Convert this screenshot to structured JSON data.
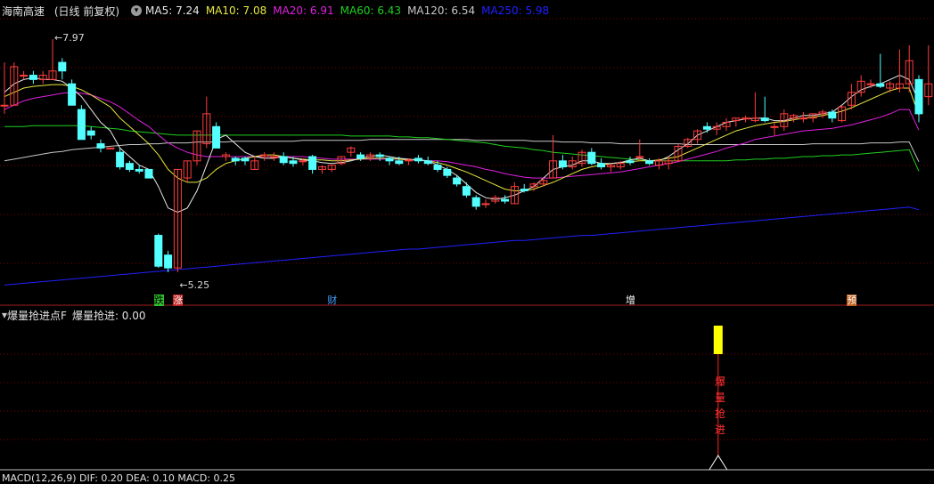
{
  "stock": {
    "name": "海南高速",
    "period": "(日线 前复权)"
  },
  "ma_legend": [
    {
      "label": "MA5: 7.24",
      "color": "#e8e8e8"
    },
    {
      "label": "MA10: 7.08",
      "color": "#e8e840"
    },
    {
      "label": "MA20: 6.91",
      "color": "#e020e0"
    },
    {
      "label": "MA60: 6.43",
      "color": "#20d020"
    },
    {
      "label": "MA120: 6.54",
      "color": "#c8c8c8"
    },
    {
      "label": "MA250: 5.98",
      "color": "#2020ff"
    }
  ],
  "price_marks": {
    "high": "7.97",
    "low": "5.25"
  },
  "event_markers": [
    {
      "text": "跌",
      "fg": "#000000",
      "bg": "#30c030"
    },
    {
      "text": "涨",
      "fg": "#ffffff",
      "bg": "#c02020"
    },
    {
      "text": "财",
      "fg": "#40a0ff",
      "bg": "none"
    },
    {
      "text": "增",
      "fg": "#ffffff",
      "bg": "none"
    },
    {
      "text": "预",
      "fg": "#ffffff",
      "bg": "#c06020"
    }
  ],
  "indicator": {
    "name": "爆量抢进点F",
    "value_label": "爆量抢进: 0.00",
    "signal_text": "爆量抢进"
  },
  "macd_legend": "MACD(12,26,9)  DIF: 0.20  DEA: 0.10  MACD: 0.25",
  "colors": {
    "up": "#ff3c3c",
    "down": "#54ffff",
    "signal_bar": "#ffff00",
    "grid": "#800000"
  },
  "chart_data": {
    "type": "candlestick",
    "y_axis_price": [
      5.0,
      8.2
    ],
    "candles": [
      {
        "o": 7.2,
        "h": 7.7,
        "l": 7.1,
        "c": 7.2
      },
      {
        "o": 7.2,
        "h": 7.7,
        "l": 7.2,
        "c": 7.65
      },
      {
        "o": 7.55,
        "h": 7.6,
        "l": 7.5,
        "c": 7.55
      },
      {
        "o": 7.55,
        "h": 7.6,
        "l": 7.45,
        "c": 7.5
      },
      {
        "o": 7.5,
        "h": 7.6,
        "l": 7.45,
        "c": 7.55
      },
      {
        "o": 7.5,
        "h": 7.97,
        "l": 7.5,
        "c": 7.6
      },
      {
        "o": 7.7,
        "h": 7.75,
        "l": 7.5,
        "c": 7.6
      },
      {
        "o": 7.45,
        "h": 7.5,
        "l": 7.2,
        "c": 7.2
      },
      {
        "o": 7.15,
        "h": 7.2,
        "l": 6.8,
        "c": 6.8
      },
      {
        "o": 6.9,
        "h": 6.95,
        "l": 6.8,
        "c": 6.85
      },
      {
        "o": 6.75,
        "h": 6.8,
        "l": 6.65,
        "c": 6.7
      },
      {
        "o": 6.7,
        "h": 6.7,
        "l": 6.7,
        "c": 6.7
      },
      {
        "o": 6.65,
        "h": 6.7,
        "l": 6.45,
        "c": 6.48
      },
      {
        "o": 6.52,
        "h": 6.55,
        "l": 6.42,
        "c": 6.45
      },
      {
        "o": 6.45,
        "h": 6.5,
        "l": 6.4,
        "c": 6.43
      },
      {
        "o": 6.45,
        "h": 6.45,
        "l": 6.4,
        "c": 6.35
      },
      {
        "o": 5.68,
        "h": 5.7,
        "l": 5.3,
        "c": 5.32
      },
      {
        "o": 5.45,
        "h": 5.5,
        "l": 5.25,
        "c": 5.3
      },
      {
        "o": 5.3,
        "h": 6.45,
        "l": 5.25,
        "c": 6.45
      },
      {
        "o": 6.35,
        "h": 6.55,
        "l": 6.3,
        "c": 6.55
      },
      {
        "o": 6.55,
        "h": 6.9,
        "l": 6.5,
        "c": 6.9
      },
      {
        "o": 6.75,
        "h": 7.3,
        "l": 6.7,
        "c": 7.1
      },
      {
        "o": 6.95,
        "h": 7.0,
        "l": 6.8,
        "c": 6.7
      },
      {
        "o": 6.6,
        "h": 6.65,
        "l": 6.55,
        "c": 6.62
      },
      {
        "o": 6.58,
        "h": 6.6,
        "l": 6.5,
        "c": 6.55
      },
      {
        "o": 6.58,
        "h": 6.6,
        "l": 6.5,
        "c": 6.55
      },
      {
        "o": 6.45,
        "h": 6.6,
        "l": 6.45,
        "c": 6.55
      },
      {
        "o": 6.6,
        "h": 6.65,
        "l": 6.55,
        "c": 6.62
      },
      {
        "o": 6.6,
        "h": 6.65,
        "l": 6.55,
        "c": 6.6
      },
      {
        "o": 6.6,
        "h": 6.65,
        "l": 6.5,
        "c": 6.53
      },
      {
        "o": 6.55,
        "h": 6.6,
        "l": 6.48,
        "c": 6.52
      },
      {
        "o": 6.55,
        "h": 6.58,
        "l": 6.5,
        "c": 6.55
      },
      {
        "o": 6.6,
        "h": 6.62,
        "l": 6.4,
        "c": 6.45
      },
      {
        "o": 6.45,
        "h": 6.5,
        "l": 6.4,
        "c": 6.48
      },
      {
        "o": 6.45,
        "h": 6.5,
        "l": 6.42,
        "c": 6.5
      },
      {
        "o": 6.52,
        "h": 6.6,
        "l": 6.5,
        "c": 6.6
      },
      {
        "o": 6.65,
        "h": 6.72,
        "l": 6.6,
        "c": 6.7
      },
      {
        "o": 6.62,
        "h": 6.65,
        "l": 6.55,
        "c": 6.58
      },
      {
        "o": 6.6,
        "h": 6.65,
        "l": 6.55,
        "c": 6.62
      },
      {
        "o": 6.62,
        "h": 6.65,
        "l": 6.55,
        "c": 6.6
      },
      {
        "o": 6.58,
        "h": 6.6,
        "l": 6.5,
        "c": 6.55
      },
      {
        "o": 6.55,
        "h": 6.6,
        "l": 6.5,
        "c": 6.52
      },
      {
        "o": 6.55,
        "h": 6.58,
        "l": 6.5,
        "c": 6.56
      },
      {
        "o": 6.58,
        "h": 6.62,
        "l": 6.52,
        "c": 6.55
      },
      {
        "o": 6.55,
        "h": 6.6,
        "l": 6.5,
        "c": 6.52
      },
      {
        "o": 6.5,
        "h": 6.55,
        "l": 6.42,
        "c": 6.45
      },
      {
        "o": 6.45,
        "h": 6.48,
        "l": 6.35,
        "c": 6.38
      },
      {
        "o": 6.35,
        "h": 6.38,
        "l": 6.25,
        "c": 6.28
      },
      {
        "o": 6.25,
        "h": 6.3,
        "l": 6.12,
        "c": 6.15
      },
      {
        "o": 6.12,
        "h": 6.15,
        "l": 5.98,
        "c": 6.02
      },
      {
        "o": 6.05,
        "h": 6.1,
        "l": 6.0,
        "c": 6.05
      },
      {
        "o": 6.08,
        "h": 6.15,
        "l": 6.05,
        "c": 6.12
      },
      {
        "o": 6.1,
        "h": 6.15,
        "l": 6.05,
        "c": 6.08
      },
      {
        "o": 6.05,
        "h": 6.3,
        "l": 6.05,
        "c": 6.25
      },
      {
        "o": 6.22,
        "h": 6.28,
        "l": 6.18,
        "c": 6.2
      },
      {
        "o": 6.25,
        "h": 6.3,
        "l": 6.2,
        "c": 6.28
      },
      {
        "o": 6.28,
        "h": 6.35,
        "l": 6.25,
        "c": 6.32
      },
      {
        "o": 6.35,
        "h": 6.85,
        "l": 6.35,
        "c": 6.55
      },
      {
        "o": 6.55,
        "h": 6.62,
        "l": 6.45,
        "c": 6.48
      },
      {
        "o": 6.48,
        "h": 6.6,
        "l": 6.45,
        "c": 6.55
      },
      {
        "o": 6.52,
        "h": 6.68,
        "l": 6.48,
        "c": 6.65
      },
      {
        "o": 6.65,
        "h": 6.7,
        "l": 6.5,
        "c": 6.52
      },
      {
        "o": 6.52,
        "h": 6.58,
        "l": 6.45,
        "c": 6.48
      },
      {
        "o": 6.48,
        "h": 6.52,
        "l": 6.42,
        "c": 6.5
      },
      {
        "o": 6.48,
        "h": 6.55,
        "l": 6.45,
        "c": 6.52
      },
      {
        "o": 6.55,
        "h": 6.6,
        "l": 6.5,
        "c": 6.53
      },
      {
        "o": 6.6,
        "h": 6.8,
        "l": 6.55,
        "c": 6.6
      },
      {
        "o": 6.55,
        "h": 6.58,
        "l": 6.5,
        "c": 6.52
      },
      {
        "o": 6.5,
        "h": 6.58,
        "l": 6.45,
        "c": 6.55
      },
      {
        "o": 6.52,
        "h": 6.6,
        "l": 6.45,
        "c": 6.55
      },
      {
        "o": 6.55,
        "h": 6.75,
        "l": 6.55,
        "c": 6.72
      },
      {
        "o": 6.72,
        "h": 6.82,
        "l": 6.7,
        "c": 6.8
      },
      {
        "o": 6.8,
        "h": 6.92,
        "l": 6.75,
        "c": 6.9
      },
      {
        "o": 6.95,
        "h": 7.0,
        "l": 6.88,
        "c": 6.92
      },
      {
        "o": 6.92,
        "h": 7.0,
        "l": 6.85,
        "c": 6.95
      },
      {
        "o": 6.95,
        "h": 7.05,
        "l": 6.9,
        "c": 7.0
      },
      {
        "o": 7.02,
        "h": 7.05,
        "l": 6.95,
        "c": 7.05
      },
      {
        "o": 7.05,
        "h": 7.08,
        "l": 7.0,
        "c": 7.05
      },
      {
        "o": 7.02,
        "h": 7.35,
        "l": 7.0,
        "c": 7.05
      },
      {
        "o": 7.05,
        "h": 7.3,
        "l": 7.0,
        "c": 7.02
      },
      {
        "o": 6.95,
        "h": 7.0,
        "l": 6.85,
        "c": 6.95
      },
      {
        "o": 6.95,
        "h": 7.15,
        "l": 6.9,
        "c": 7.1
      },
      {
        "o": 7.05,
        "h": 7.1,
        "l": 7.0,
        "c": 7.08
      },
      {
        "o": 7.05,
        "h": 7.12,
        "l": 7.0,
        "c": 7.05
      },
      {
        "o": 7.05,
        "h": 7.1,
        "l": 7.0,
        "c": 7.1
      },
      {
        "o": 7.1,
        "h": 7.15,
        "l": 7.05,
        "c": 7.12
      },
      {
        "o": 7.12,
        "h": 7.15,
        "l": 7.0,
        "c": 7.05
      },
      {
        "o": 7.02,
        "h": 7.2,
        "l": 7.0,
        "c": 7.18
      },
      {
        "o": 7.2,
        "h": 7.45,
        "l": 7.15,
        "c": 7.35
      },
      {
        "o": 7.35,
        "h": 7.55,
        "l": 7.3,
        "c": 7.48
      },
      {
        "o": 7.45,
        "h": 7.5,
        "l": 7.4,
        "c": 7.45
      },
      {
        "o": 7.45,
        "h": 7.8,
        "l": 7.4,
        "c": 7.42
      },
      {
        "o": 7.4,
        "h": 7.48,
        "l": 7.35,
        "c": 7.45
      },
      {
        "o": 7.4,
        "h": 7.85,
        "l": 7.35,
        "c": 7.45
      },
      {
        "o": 7.45,
        "h": 7.9,
        "l": 7.35,
        "c": 7.72
      },
      {
        "o": 7.5,
        "h": 7.55,
        "l": 7.0,
        "c": 7.1
      },
      {
        "o": 7.3,
        "h": 7.9,
        "l": 7.2,
        "c": 7.45
      }
    ],
    "ma5": [
      7.35,
      7.45,
      7.5,
      7.52,
      7.5,
      7.5,
      7.48,
      7.4,
      7.3,
      7.15,
      7.0,
      6.9,
      6.7,
      6.6,
      6.5,
      6.45,
      6.25,
      6.0,
      5.95,
      6.0,
      6.2,
      6.5,
      6.8,
      6.85,
      6.75,
      6.65,
      6.6,
      6.58,
      6.58,
      6.6,
      6.58,
      6.56,
      6.55,
      6.53,
      6.52,
      6.53,
      6.55,
      6.58,
      6.6,
      6.62,
      6.6,
      6.58,
      6.57,
      6.56,
      6.55,
      6.5,
      6.45,
      6.38,
      6.28,
      6.18,
      6.12,
      6.1,
      6.12,
      6.15,
      6.2,
      6.25,
      6.35,
      6.45,
      6.48,
      6.5,
      6.55,
      6.55,
      6.52,
      6.52,
      6.53,
      6.56,
      6.58,
      6.55,
      6.55,
      6.6,
      6.68,
      6.75,
      6.85,
      6.9,
      6.95,
      7.0,
      7.02,
      7.04,
      7.05,
      7.05,
      7.02,
      7.02,
      7.05,
      7.08,
      7.08,
      7.1,
      7.12,
      7.2,
      7.3,
      7.38,
      7.42,
      7.45,
      7.5,
      7.55,
      7.5,
      7.24
    ],
    "ma10": [
      7.3,
      7.35,
      7.4,
      7.42,
      7.43,
      7.44,
      7.44,
      7.42,
      7.38,
      7.32,
      7.25,
      7.18,
      7.05,
      6.95,
      6.85,
      6.75,
      6.62,
      6.45,
      6.35,
      6.3,
      6.3,
      6.35,
      6.45,
      6.52,
      6.55,
      6.58,
      6.6,
      6.62,
      6.62,
      6.6,
      6.58,
      6.57,
      6.56,
      6.56,
      6.55,
      6.55,
      6.56,
      6.57,
      6.58,
      6.58,
      6.58,
      6.57,
      6.56,
      6.56,
      6.55,
      6.53,
      6.5,
      6.46,
      6.42,
      6.37,
      6.32,
      6.27,
      6.22,
      6.2,
      6.2,
      6.22,
      6.26,
      6.3,
      6.35,
      6.4,
      6.45,
      6.48,
      6.5,
      6.52,
      6.53,
      6.54,
      6.55,
      6.55,
      6.56,
      6.58,
      6.6,
      6.65,
      6.7,
      6.75,
      6.8,
      6.85,
      6.9,
      6.93,
      6.96,
      6.98,
      7.0,
      7.01,
      7.03,
      7.05,
      7.06,
      7.08,
      7.1,
      7.13,
      7.17,
      7.22,
      7.27,
      7.32,
      7.37,
      7.4,
      7.4,
      7.08
    ],
    "ma20": [
      7.15,
      7.2,
      7.25,
      7.28,
      7.3,
      7.32,
      7.34,
      7.35,
      7.34,
      7.32,
      7.28,
      7.24,
      7.18,
      7.1,
      7.02,
      6.95,
      6.85,
      6.76,
      6.7,
      6.65,
      6.62,
      6.6,
      6.6,
      6.6,
      6.6,
      6.6,
      6.6,
      6.6,
      6.6,
      6.6,
      6.6,
      6.6,
      6.59,
      6.58,
      6.57,
      6.57,
      6.57,
      6.57,
      6.57,
      6.57,
      6.57,
      6.57,
      6.56,
      6.56,
      6.55,
      6.55,
      6.54,
      6.52,
      6.5,
      6.48,
      6.45,
      6.43,
      6.4,
      6.38,
      6.36,
      6.35,
      6.35,
      6.35,
      6.36,
      6.37,
      6.38,
      6.39,
      6.4,
      6.41,
      6.42,
      6.44,
      6.46,
      6.48,
      6.5,
      6.52,
      6.54,
      6.57,
      6.6,
      6.63,
      6.66,
      6.7,
      6.73,
      6.76,
      6.8,
      6.82,
      6.84,
      6.86,
      6.88,
      6.9,
      6.91,
      6.92,
      6.93,
      6.95,
      6.97,
      7.0,
      7.03,
      7.06,
      7.1,
      7.15,
      7.15,
      6.91
    ],
    "ma60": [
      6.95,
      6.95,
      6.95,
      6.96,
      6.96,
      6.96,
      6.96,
      6.96,
      6.96,
      6.95,
      6.94,
      6.93,
      6.92,
      6.9,
      6.89,
      6.88,
      6.87,
      6.86,
      6.85,
      6.85,
      6.85,
      6.85,
      6.85,
      6.85,
      6.85,
      6.85,
      6.85,
      6.85,
      6.85,
      6.85,
      6.85,
      6.85,
      6.85,
      6.85,
      6.85,
      6.85,
      6.84,
      6.84,
      6.84,
      6.84,
      6.84,
      6.83,
      6.83,
      6.82,
      6.82,
      6.81,
      6.8,
      6.79,
      6.78,
      6.77,
      6.76,
      6.74,
      6.72,
      6.71,
      6.7,
      6.68,
      6.67,
      6.65,
      6.64,
      6.63,
      6.62,
      6.61,
      6.6,
      6.59,
      6.58,
      6.57,
      6.56,
      6.55,
      6.55,
      6.55,
      6.55,
      6.55,
      6.55,
      6.55,
      6.55,
      6.55,
      6.56,
      6.56,
      6.57,
      6.57,
      6.58,
      6.58,
      6.59,
      6.6,
      6.6,
      6.61,
      6.61,
      6.62,
      6.62,
      6.63,
      6.64,
      6.65,
      6.66,
      6.67,
      6.68,
      6.43
    ],
    "ma120": [
      6.55,
      6.57,
      6.59,
      6.61,
      6.63,
      6.65,
      6.66,
      6.68,
      6.69,
      6.7,
      6.71,
      6.72,
      6.73,
      6.74,
      6.74,
      6.75,
      6.75,
      6.76,
      6.76,
      6.76,
      6.77,
      6.77,
      6.77,
      6.77,
      6.78,
      6.78,
      6.78,
      6.78,
      6.78,
      6.78,
      6.78,
      6.79,
      6.79,
      6.79,
      6.79,
      6.79,
      6.79,
      6.79,
      6.8,
      6.8,
      6.8,
      6.8,
      6.8,
      6.8,
      6.8,
      6.8,
      6.8,
      6.8,
      6.8,
      6.79,
      6.79,
      6.79,
      6.79,
      6.79,
      6.79,
      6.78,
      6.78,
      6.78,
      6.77,
      6.77,
      6.77,
      6.76,
      6.76,
      6.76,
      6.75,
      6.75,
      6.75,
      6.75,
      6.75,
      6.75,
      6.75,
      6.74,
      6.74,
      6.74,
      6.74,
      6.74,
      6.74,
      6.74,
      6.74,
      6.74,
      6.74,
      6.74,
      6.74,
      6.74,
      6.75,
      6.75,
      6.75,
      6.75,
      6.75,
      6.75,
      6.76,
      6.76,
      6.76,
      6.77,
      6.77,
      6.54
    ],
    "ma250": [
      5.1,
      5.11,
      5.12,
      5.13,
      5.14,
      5.15,
      5.16,
      5.17,
      5.18,
      5.19,
      5.2,
      5.21,
      5.22,
      5.23,
      5.24,
      5.25,
      5.26,
      5.27,
      5.28,
      5.29,
      5.3,
      5.31,
      5.32,
      5.33,
      5.34,
      5.35,
      5.36,
      5.37,
      5.38,
      5.39,
      5.4,
      5.41,
      5.42,
      5.43,
      5.44,
      5.45,
      5.46,
      5.47,
      5.48,
      5.49,
      5.5,
      5.51,
      5.52,
      5.52,
      5.53,
      5.54,
      5.55,
      5.56,
      5.57,
      5.58,
      5.59,
      5.6,
      5.61,
      5.62,
      5.62,
      5.63,
      5.64,
      5.65,
      5.66,
      5.67,
      5.68,
      5.68,
      5.69,
      5.7,
      5.71,
      5.72,
      5.73,
      5.74,
      5.75,
      5.76,
      5.77,
      5.78,
      5.79,
      5.8,
      5.81,
      5.82,
      5.83,
      5.84,
      5.85,
      5.86,
      5.87,
      5.88,
      5.89,
      5.9,
      5.91,
      5.92,
      5.93,
      5.94,
      5.95,
      5.96,
      5.97,
      5.98,
      5.99,
      6.0,
      6.01,
      5.98
    ],
    "signal_index": 66,
    "signal_value": 1
  }
}
